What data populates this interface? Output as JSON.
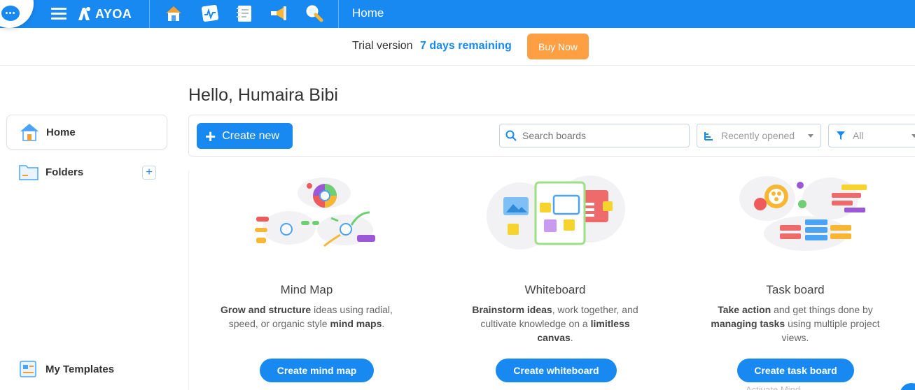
{
  "topbar": {
    "app_name": "AYOA",
    "page_title": "Home",
    "nav_icons": [
      "home-icon",
      "activity-icon",
      "notes-icon",
      "megaphone-icon",
      "search-icon"
    ],
    "color": "#1789f0"
  },
  "trial": {
    "text": "Trial version",
    "days": "7 days remaining",
    "buy_label": "Buy Now",
    "buy_color": "#ff9f43"
  },
  "sidebar": {
    "items": [
      {
        "label": "Home",
        "icon": "home-icon",
        "active": true
      },
      {
        "label": "Folders",
        "icon": "folder-icon",
        "active": false
      }
    ],
    "add_label": "+",
    "templates_label": "My Templates"
  },
  "main": {
    "greeting": "Hello, Humaira Bibi",
    "create_label": "Create new",
    "search_placeholder": "Search boards",
    "sort_value": "Recently opened",
    "filter_value": "All"
  },
  "cards": [
    {
      "title": "Mind Map",
      "desc_parts": [
        "Grow and structure",
        " ideas using radial, speed, or organic style ",
        "mind maps",
        "."
      ],
      "button": "Create mind map"
    },
    {
      "title": "Whiteboard",
      "desc_parts": [
        "Brainstorm ideas",
        ", work together, and cultivate knowledge on a ",
        "limitless canvas",
        "."
      ],
      "button": "Create whiteboard"
    },
    {
      "title": "Task board",
      "desc_parts": [
        "Take action",
        " and get things done by ",
        "managing tasks",
        " using multiple project views."
      ],
      "button": "Create task board"
    }
  ],
  "footer_partial": "Activate Mind..."
}
